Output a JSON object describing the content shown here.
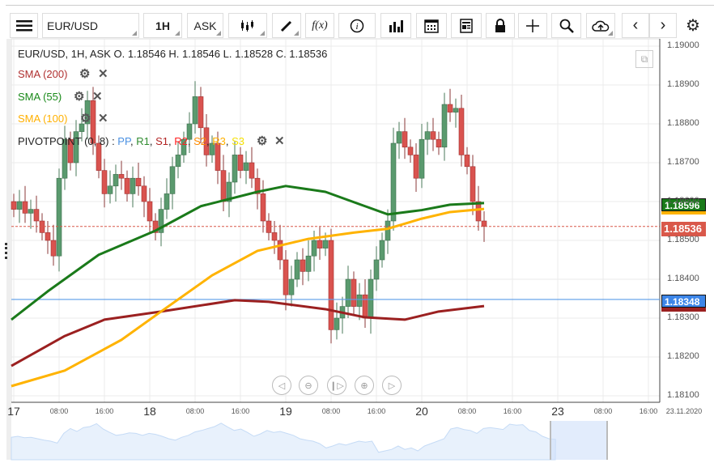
{
  "toolbar": {
    "symbol": "EUR/USD",
    "interval": "1H",
    "price_type": "ASK",
    "fx_label": "f(x)"
  },
  "legend": {
    "ohlc_line": "EUR/USD, 1H, ASK   O. 1.18546 H. 1.18546 L. 1.18528 C. 1.18536",
    "sma200": "SMA (200)",
    "sma55": "SMA (55)",
    "sma100": "SMA (100)",
    "pivot": "PIVOTPOINT (0, 8)",
    "pivot_sep": " : ",
    "pivot_parts": [
      {
        "t": "PP",
        "c": "#4a90e2"
      },
      {
        "t": "R1",
        "c": "#2e8b2e"
      },
      {
        "t": "S1",
        "c": "#b22222"
      },
      {
        "t": "R2",
        "c": "#ff2020"
      },
      {
        "t": "S2",
        "c": "#ff8c00"
      },
      {
        "t": "R3",
        "c": "#ffb000"
      },
      {
        "t": "S3",
        "c": "#f5e000"
      }
    ]
  },
  "price_tags": {
    "sma55": "1.18596",
    "current": "1.18536",
    "pivot": "1.18348"
  },
  "colors": {
    "up": "#5a9a6e",
    "down": "#d9534f",
    "sma200": "#9b2020",
    "sma55": "#1a7a1a",
    "sma100": "#ffb300",
    "pivot": "#5b9ce8",
    "current": "#d9584a"
  },
  "chart_data": {
    "type": "candlestick",
    "ylim": [
      1.1808,
      1.1905
    ],
    "y_ticks": [
      "1.19000",
      "1.18900",
      "1.18800",
      "1.18700",
      "1.18600",
      "1.18500",
      "1.18400",
      "1.18300",
      "1.18200",
      "1.18100"
    ],
    "x_ticks": [
      {
        "h": 0,
        "t": "17",
        "day": true
      },
      {
        "h": 8,
        "t": "08:00"
      },
      {
        "h": 16,
        "t": "16:00"
      },
      {
        "h": 24,
        "t": "18",
        "day": true
      },
      {
        "h": 32,
        "t": "08:00"
      },
      {
        "h": 40,
        "t": "16:00"
      },
      {
        "h": 48,
        "t": "19",
        "day": true
      },
      {
        "h": 56,
        "t": "08:00"
      },
      {
        "h": 64,
        "t": "16:00"
      },
      {
        "h": 72,
        "t": "20",
        "day": true
      },
      {
        "h": 80,
        "t": "08:00"
      },
      {
        "h": 88,
        "t": "16:00"
      },
      {
        "h": 96,
        "t": "23",
        "day": true
      },
      {
        "h": 104,
        "t": "08:00"
      },
      {
        "h": 112,
        "t": "16:00"
      },
      {
        "h": 117,
        "t": "23.11.2020"
      }
    ],
    "closes": [
      1.1858,
      1.186,
      1.1857,
      1.1858,
      1.1855,
      1.1852,
      1.185,
      1.1846,
      1.1866,
      1.1876,
      1.187,
      1.1878,
      1.188,
      1.1886,
      1.1875,
      1.1868,
      1.1862,
      1.1864,
      1.1867,
      1.1866,
      1.1862,
      1.1866,
      1.1864,
      1.186,
      1.1855,
      1.1852,
      1.1858,
      1.1862,
      1.1869,
      1.1872,
      1.1876,
      1.188,
      1.1887,
      1.1879,
      1.1872,
      1.1875,
      1.1868,
      1.186,
      1.1865,
      1.1872,
      1.1868,
      1.187,
      1.1866,
      1.1862,
      1.1855,
      1.1852,
      1.185,
      1.1845,
      1.1836,
      1.184,
      1.1845,
      1.1842,
      1.1846,
      1.185,
      1.1848,
      1.185,
      1.1827,
      1.183,
      1.1833,
      1.184,
      1.1833,
      1.1836,
      1.183,
      1.184,
      1.1845,
      1.185,
      1.1855,
      1.1875,
      1.1878,
      1.1874,
      1.1872,
      1.1866,
      1.1876,
      1.1878,
      1.1876,
      1.1874,
      1.1885,
      1.1883,
      1.1884,
      1.1872,
      1.1869,
      1.186,
      1.1855,
      1.18536
    ],
    "sma55": [
      [
        0,
        1.18296
      ],
      [
        6,
        1.18369
      ],
      [
        15,
        1.18463
      ],
      [
        25,
        1.18525
      ],
      [
        33,
        1.18588
      ],
      [
        43,
        1.18625
      ],
      [
        48,
        1.1864
      ],
      [
        55,
        1.18625
      ],
      [
        62,
        1.18588
      ],
      [
        66,
        1.18567
      ],
      [
        72,
        1.18578
      ],
      [
        77,
        1.18592
      ],
      [
        83,
        1.18596
      ]
    ],
    "sma100": [
      [
        0,
        1.18125
      ],
      [
        9,
        1.18165
      ],
      [
        19,
        1.18244
      ],
      [
        26,
        1.18317
      ],
      [
        35,
        1.1841
      ],
      [
        43,
        1.18473
      ],
      [
        52,
        1.18504
      ],
      [
        60,
        1.1852
      ],
      [
        66,
        1.1853
      ],
      [
        72,
        1.18556
      ],
      [
        77,
        1.18573
      ],
      [
        83,
        1.18581
      ]
    ],
    "sma200": [
      [
        0,
        1.18177
      ],
      [
        9,
        1.18254
      ],
      [
        16,
        1.18296
      ],
      [
        26,
        1.18317
      ],
      [
        39,
        1.18346
      ],
      [
        45,
        1.18342
      ],
      [
        55,
        1.18323
      ],
      [
        62,
        1.18302
      ],
      [
        69,
        1.18296
      ],
      [
        75,
        1.18317
      ],
      [
        83,
        1.18331
      ]
    ],
    "pivot": 1.18348,
    "current": 1.18536
  }
}
